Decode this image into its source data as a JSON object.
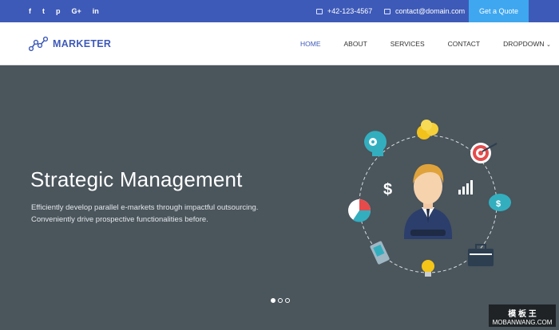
{
  "topbar": {
    "social": [
      "f",
      "t",
      "p",
      "G+",
      "in"
    ],
    "phone": "+42-123-4567",
    "email": "contact@domain.com",
    "quote_button": "Get a Quote"
  },
  "nav": {
    "brand": "MARKETER",
    "items": [
      "HOME",
      "ABOUT",
      "SERVICES",
      "CONTACT",
      "DROPDOWN"
    ]
  },
  "hero": {
    "title": "Strategic Management",
    "line1": "Efficiently develop parallel e-markets through impactful outsourcing.",
    "line2": "Conveniently drive prospective functionalities before."
  },
  "watermark": {
    "main": "模 板 王",
    "sub": "MOBANWANG.COM"
  },
  "colors": {
    "topbar": "#3e5ab8",
    "quote": "#3ea7f0",
    "hero_bg": "#4a555c"
  }
}
